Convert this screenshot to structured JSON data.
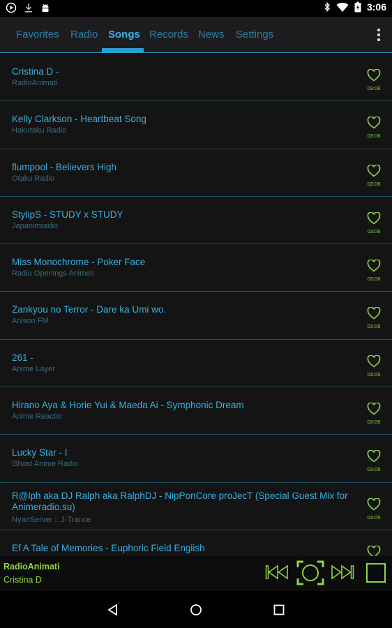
{
  "status_bar": {
    "time": "3:06",
    "left_icons": [
      "play-circle-icon",
      "download-icon",
      "android-icon"
    ],
    "right_icons": [
      "bluetooth-icon",
      "wifi-icon",
      "battery-icon"
    ]
  },
  "tabs": [
    {
      "label": "Favorites",
      "active": false
    },
    {
      "label": "Radio",
      "active": false
    },
    {
      "label": "Songs",
      "active": true
    },
    {
      "label": "Records",
      "active": false
    },
    {
      "label": "News",
      "active": false
    },
    {
      "label": "Settings",
      "active": false
    }
  ],
  "songs": [
    {
      "title": "Cristina D -",
      "station": "RadioAnimati",
      "time": "03:06"
    },
    {
      "title": "Kelly Clarkson - Heartbeat Song",
      "station": "Hakutaku Radio",
      "time": "03:06"
    },
    {
      "title": "flumpool - Believers High",
      "station": "Otaku Radio",
      "time": "03:06"
    },
    {
      "title": "StylipS - STUDY x STUDY",
      "station": "Japanimradio",
      "time": "03:06"
    },
    {
      "title": "Miss Monochrome - Poker Face",
      "station": "Radio Openings Animes",
      "time": "03:06"
    },
    {
      "title": "Zankyou no Terror - Dare ka Umi wo.",
      "station": "Anison FM",
      "time": "03:06"
    },
    {
      "title": "261 -",
      "station": "Anime Layer",
      "time": "03:05"
    },
    {
      "title": "Hirano Aya & Horie Yui & Maeda Ai - Symphonic Dream",
      "station": "Anime Reactor",
      "time": "03:05"
    },
    {
      "title": "Lucky Star - I",
      "station": "Ghost Anime Radio",
      "time": "03:05"
    },
    {
      "title": "R@lph aka DJ Ralph aka RalphDJ - NipPonCore proJecT (Special Guest Mix for Animeradio.su)",
      "station": "NyanServer :: J-Trance",
      "time": "03:05"
    },
    {
      "title": "Ef A Tale of Memories - Euphoric Field English",
      "station": "",
      "time": ""
    }
  ],
  "player": {
    "station": "RadioAnimati",
    "song": "Cristina D",
    "accent_color": "#8fd44a"
  },
  "colors": {
    "title": "#3aaee0",
    "tab_active": "#35b4ea",
    "accent_green": "#8fd44a",
    "background": "#141414"
  }
}
